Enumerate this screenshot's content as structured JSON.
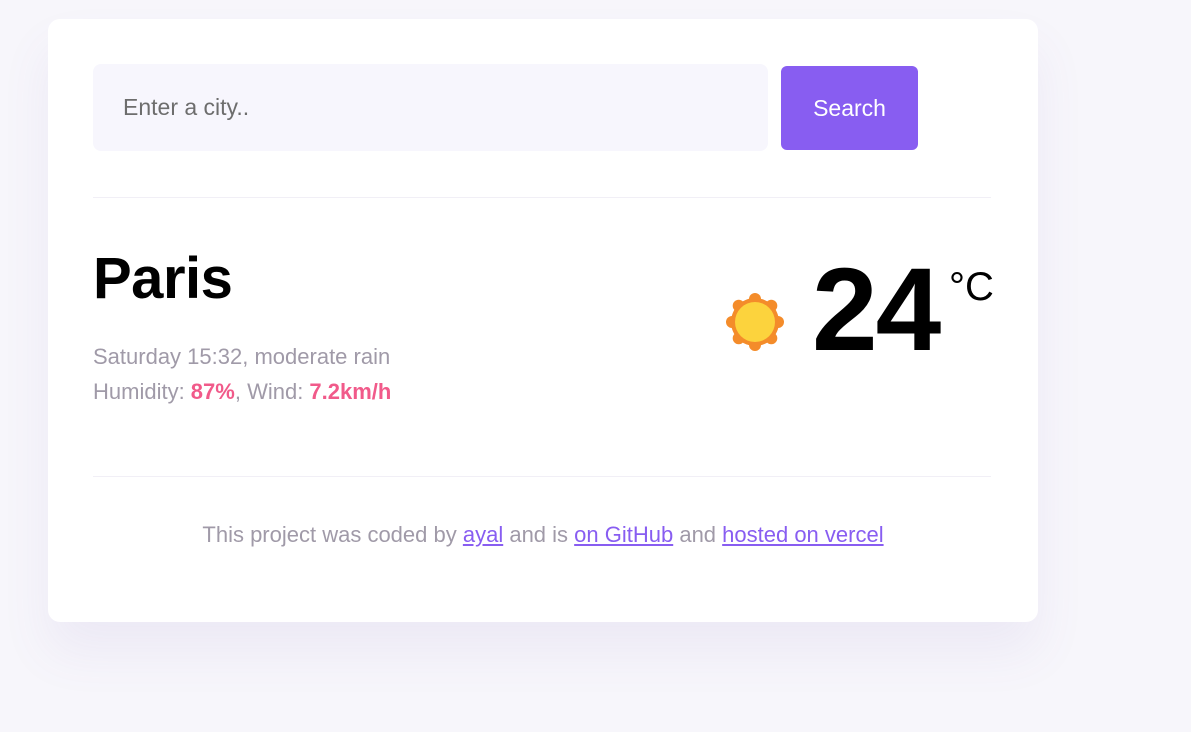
{
  "search": {
    "placeholder": "Enter a city..",
    "button_label": "Search"
  },
  "weather": {
    "city": "Paris",
    "day_time": "Saturday 15:32",
    "description": "moderate rain",
    "humidity_label": "Humidity: ",
    "humidity_value": "87%",
    "wind_label": ", Wind: ",
    "wind_value": "7.2km/h",
    "temperature": "24",
    "unit": "°C",
    "icon": "sun-icon"
  },
  "colors": {
    "accent": "#885df1",
    "highlight": "#f15a8a",
    "muted_text": "#a09aa8",
    "sun_fill": "#fcd33d",
    "sun_rays": "#f48c2a"
  },
  "footer": {
    "prefix": "This project was coded by ",
    "author_link": "ayal",
    "middle": " and is ",
    "github_link": "on GitHub",
    "and": " and ",
    "hosted_link": "hosted on vercel"
  }
}
